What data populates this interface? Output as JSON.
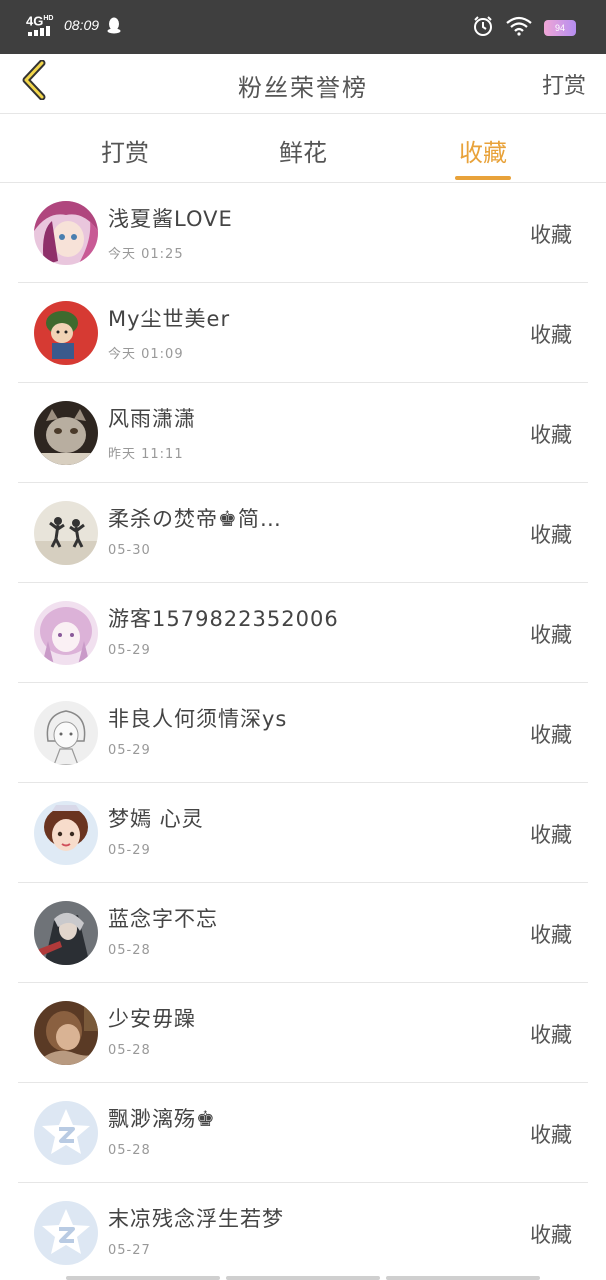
{
  "status_bar": {
    "network": "4G",
    "network_sup": "HD",
    "time": "08:09",
    "battery": "94"
  },
  "nav": {
    "title": "粉丝荣誉榜",
    "action": "打赏"
  },
  "tabs": [
    {
      "label": "打赏",
      "active": false
    },
    {
      "label": "鲜花",
      "active": false
    },
    {
      "label": "收藏",
      "active": true
    }
  ],
  "colors": {
    "accent": "#e8a23a",
    "status_bar": "#3f3f3f"
  },
  "list": [
    {
      "name": "浅夏酱LOVE",
      "time": "今天 01:25",
      "action": "收藏",
      "avatar": "anime-girl-pink-hair"
    },
    {
      "name": "My尘世美er",
      "time": "今天 01:09",
      "action": "收藏",
      "avatar": "cartoon-boy-red"
    },
    {
      "name": "风雨潇潇",
      "time": "昨天 11:11",
      "action": "收藏",
      "avatar": "cat-photo"
    },
    {
      "name": "柔杀の焚帝♚简…",
      "time": "05-30",
      "action": "收藏",
      "avatar": "couple-beach"
    },
    {
      "name": "游客1579822352006",
      "time": "05-29",
      "action": "收藏",
      "avatar": "anime-girl-lilac"
    },
    {
      "name": "非良人何须情深ys",
      "time": "05-29",
      "action": "收藏",
      "avatar": "sketch-girl"
    },
    {
      "name": "梦嫣 心灵",
      "time": "05-29",
      "action": "收藏",
      "avatar": "doll-girl"
    },
    {
      "name": "蓝念字不忘",
      "time": "05-28",
      "action": "收藏",
      "avatar": "game-character"
    },
    {
      "name": "少安毋躁",
      "time": "05-28",
      "action": "收藏",
      "avatar": "brown-portrait"
    },
    {
      "name": "飘渺漓殇♚",
      "time": "05-28",
      "action": "收藏",
      "avatar": "default-star"
    },
    {
      "name": "末凉残念浮生若梦",
      "time": "05-27",
      "action": "收藏",
      "avatar": "default-star"
    }
  ]
}
